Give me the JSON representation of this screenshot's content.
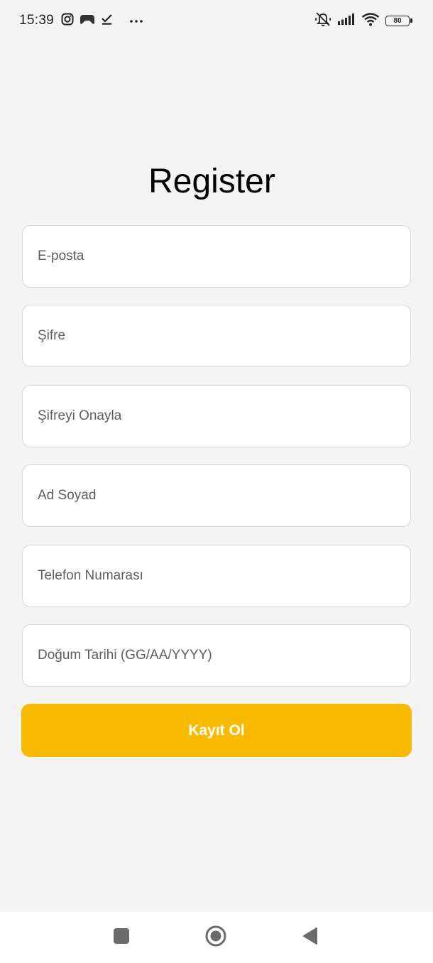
{
  "status_bar": {
    "time": "15:39",
    "battery_level": "80",
    "left_icons": [
      "instagram-icon",
      "game-controller-icon",
      "download-done-icon",
      "more-dots-icon"
    ],
    "right_icons": [
      "vibrate-mute-icon",
      "signal-icon",
      "wifi-icon",
      "battery-icon"
    ]
  },
  "page": {
    "title": "Register"
  },
  "form": {
    "email_placeholder": "E-posta",
    "password_placeholder": "Şifre",
    "confirm_password_placeholder": "Şifreyi Onayla",
    "full_name_placeholder": "Ad Soyad",
    "phone_placeholder": "Telefon Numarası",
    "birth_date_placeholder": "Doğum Tarihi (GG/AA/YYYY)",
    "submit_label": "Kayıt Ol"
  },
  "colors": {
    "background": "#f4f4f4",
    "accent": "#f9bb02",
    "field_border": "#d8d8d8",
    "placeholder": "#5e5e5e"
  },
  "nav_bar": {
    "buttons": [
      "recents-square-icon",
      "home-circle-icon",
      "back-triangle-icon"
    ]
  }
}
